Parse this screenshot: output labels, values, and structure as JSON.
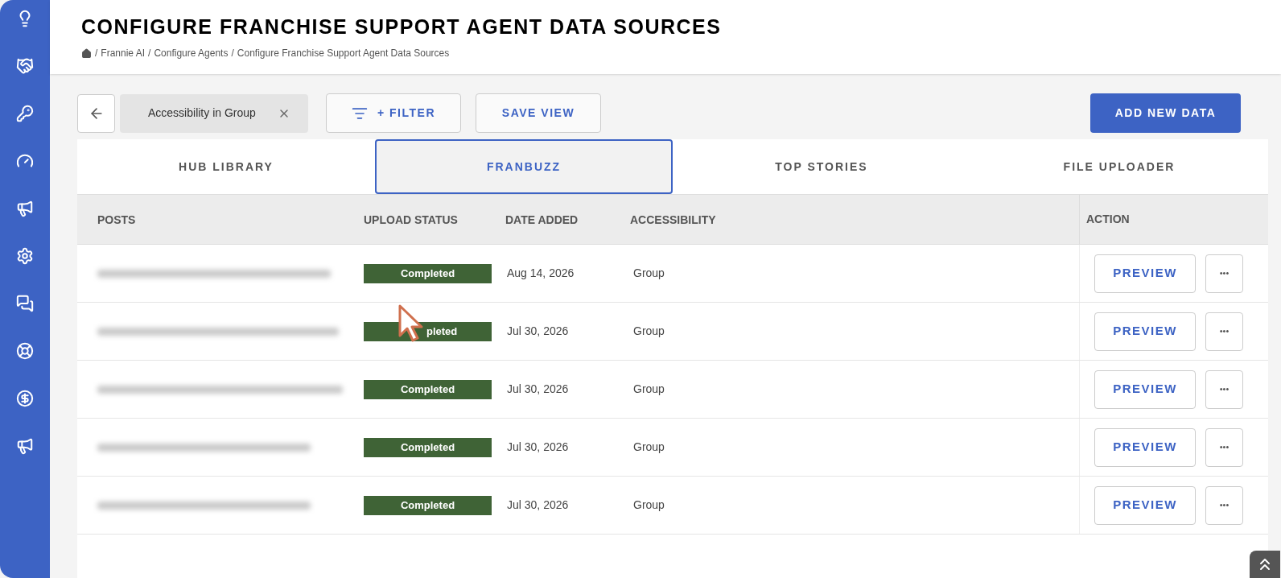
{
  "sidebar": {
    "items": [
      {
        "kind": "bulb"
      },
      {
        "kind": "handshake"
      },
      {
        "kind": "key"
      },
      {
        "kind": "gauge"
      },
      {
        "kind": "megaphone"
      },
      {
        "kind": "gear"
      },
      {
        "kind": "chat"
      },
      {
        "kind": "lifebuoy"
      },
      {
        "kind": "moneybag"
      },
      {
        "kind": "megaphone"
      }
    ]
  },
  "header": {
    "title": "CONFIGURE FRANCHISE SUPPORT AGENT DATA SOURCES",
    "separator": "/",
    "breadcrumb": [
      "Frannie AI",
      "Configure Agents",
      "Configure Franchise Support Agent Data Sources"
    ]
  },
  "toolbar": {
    "filter_chip": "Accessibility in Group",
    "filter_button": "+ FILTER",
    "save_view": "SAVE VIEW",
    "add_button": "ADD NEW DATA"
  },
  "tabs": [
    {
      "label": "HUB LIBRARY",
      "selected": false
    },
    {
      "label": "FRANBUZZ",
      "selected": true
    },
    {
      "label": "TOP STORIES",
      "selected": false
    },
    {
      "label": "FILE UPLOADER",
      "selected": false
    }
  ],
  "table": {
    "columns": [
      "POSTS",
      "UPLOAD STATUS",
      "DATE ADDED",
      "ACCESSIBILITY",
      "ACTION"
    ],
    "rows": [
      {
        "status": "Completed",
        "date": "Aug 14, 2026",
        "accessibility": "Group",
        "action": "PREVIEW",
        "more": "•••"
      },
      {
        "status": "pleted",
        "cursor_over": true,
        "date": "Jul 30, 2026",
        "accessibility": "Group",
        "action": "PREVIEW",
        "more": "•••"
      },
      {
        "status": "Completed",
        "date": "Jul 30, 2026",
        "accessibility": "Group",
        "action": "PREVIEW",
        "more": "•••"
      },
      {
        "status": "Completed",
        "date": "Jul 30, 2026",
        "accessibility": "Group",
        "action": "PREVIEW",
        "more": "•••"
      },
      {
        "status": "Completed",
        "date": "Jul 30, 2026",
        "accessibility": "Group",
        "action": "PREVIEW",
        "more": "•••"
      }
    ]
  }
}
